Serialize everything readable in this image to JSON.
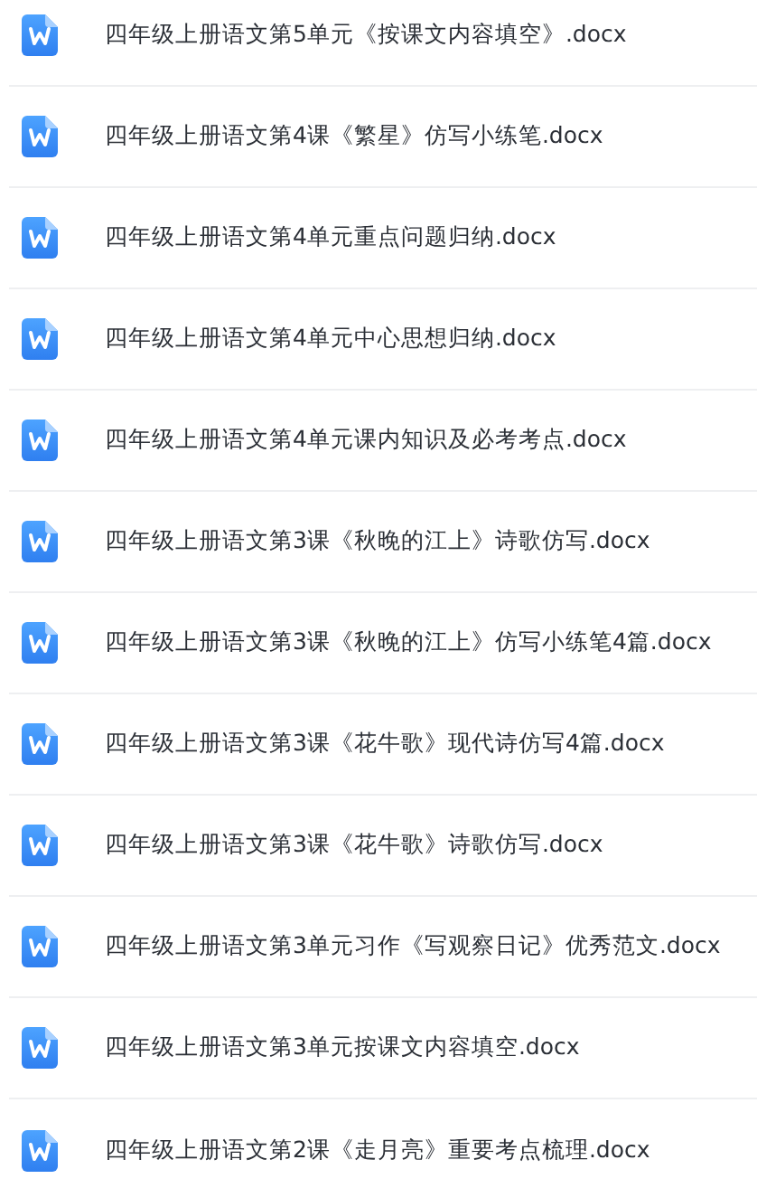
{
  "files": [
    {
      "name": "四年级上册语文第5单元《按课文内容填空》.docx"
    },
    {
      "name": "四年级上册语文第4课《繁星》仿写小练笔.docx"
    },
    {
      "name": "四年级上册语文第4单元重点问题归纳.docx"
    },
    {
      "name": "四年级上册语文第4单元中心思想归纳.docx"
    },
    {
      "name": "四年级上册语文第4单元课内知识及必考考点.docx"
    },
    {
      "name": "四年级上册语文第3课《秋晚的江上》诗歌仿写.docx"
    },
    {
      "name": "四年级上册语文第3课《秋晚的江上》仿写小练笔4篇.docx"
    },
    {
      "name": "四年级上册语文第3课《花牛歌》现代诗仿写4篇.docx"
    },
    {
      "name": "四年级上册语文第3课《花牛歌》诗歌仿写.docx"
    },
    {
      "name": "四年级上册语文第3单元习作《写观察日记》优秀范文.docx"
    },
    {
      "name": "四年级上册语文第3单元按课文内容填空.docx"
    },
    {
      "name": "四年级上册语文第2课《走月亮》重要考点梳理.docx"
    }
  ]
}
